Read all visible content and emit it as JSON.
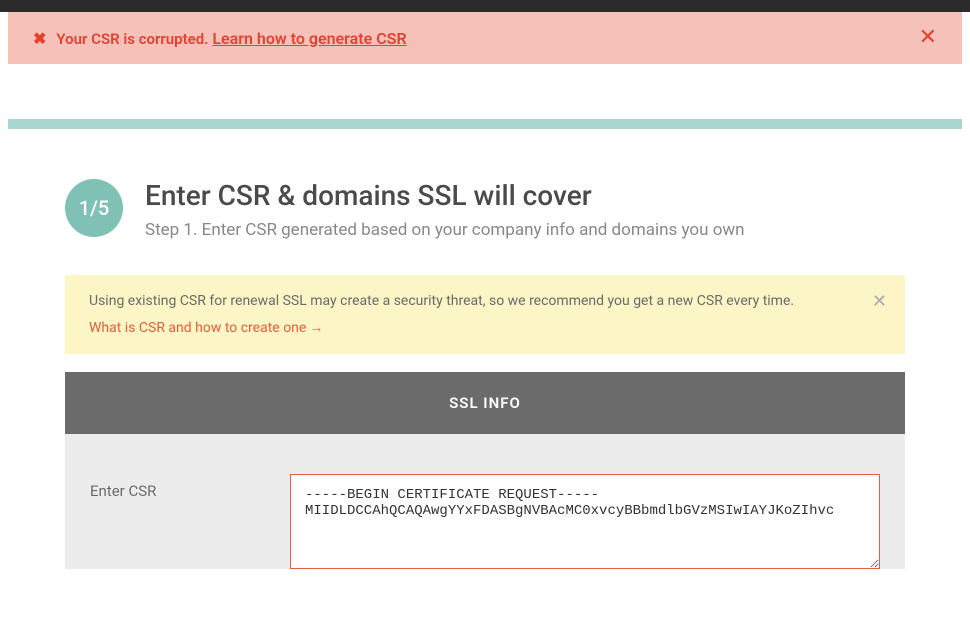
{
  "errorBanner": {
    "message": "Your CSR is corrupted.",
    "linkText": "Learn how to generate CSR"
  },
  "stepHeader": {
    "indicator": "1/5",
    "title": "Enter CSR & domains SSL will cover",
    "subtitle": "Step 1. Enter CSR generated based on your company info and domains you own"
  },
  "warning": {
    "text": "Using existing CSR for renewal SSL may create a security threat, so we recommend you get a new CSR every time.",
    "linkText": "What is CSR and how to create one",
    "arrow": "→"
  },
  "sslPanel": {
    "header": "SSL INFO",
    "csrLabel": "Enter CSR",
    "csrValue": "-----BEGIN CERTIFICATE REQUEST-----\nMIIDLDCCAhQCAQAwgYYxFDASBgNVBAcMC0xvcyBBbmdlbGVzMSIwIAYJKoZIhvc"
  }
}
